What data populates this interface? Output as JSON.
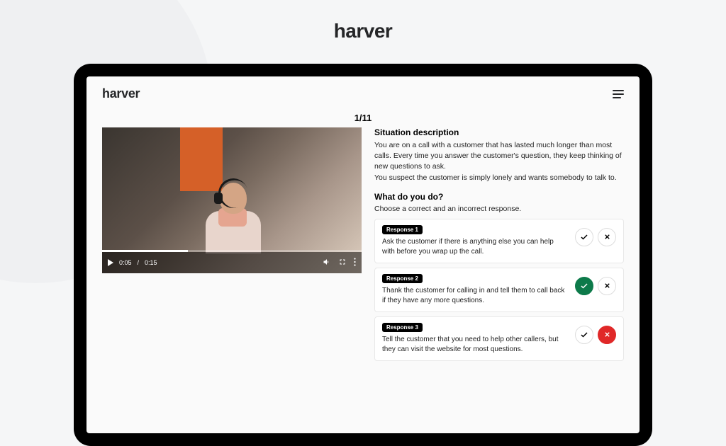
{
  "outer": {
    "logo": "harver"
  },
  "app": {
    "logo": "harver",
    "progress": "1/11"
  },
  "video": {
    "current_time": "0:05",
    "duration": "0:15"
  },
  "situation": {
    "title": "Situation description",
    "line1": "You are on a call with a customer that has lasted much longer than most calls. Every time you answer the customer's question, they keep thinking of new questions to ask.",
    "line2": "You suspect the customer is simply lonely and wants somebody to talk to."
  },
  "question": {
    "title": "What do you do?",
    "instruction": "Choose a correct and an incorrect response."
  },
  "responses": [
    {
      "badge": "Response 1",
      "text": "Ask the customer if there is anything else you can help with before you wrap up the call.",
      "correct_selected": false,
      "incorrect_selected": false
    },
    {
      "badge": "Response 2",
      "text": "Thank the customer for calling in and tell them to call back if they have any more questions.",
      "correct_selected": true,
      "incorrect_selected": false
    },
    {
      "badge": "Response 3",
      "text": "Tell the customer that you need to help other callers, but they can visit the website for most questions.",
      "correct_selected": false,
      "incorrect_selected": true
    }
  ]
}
